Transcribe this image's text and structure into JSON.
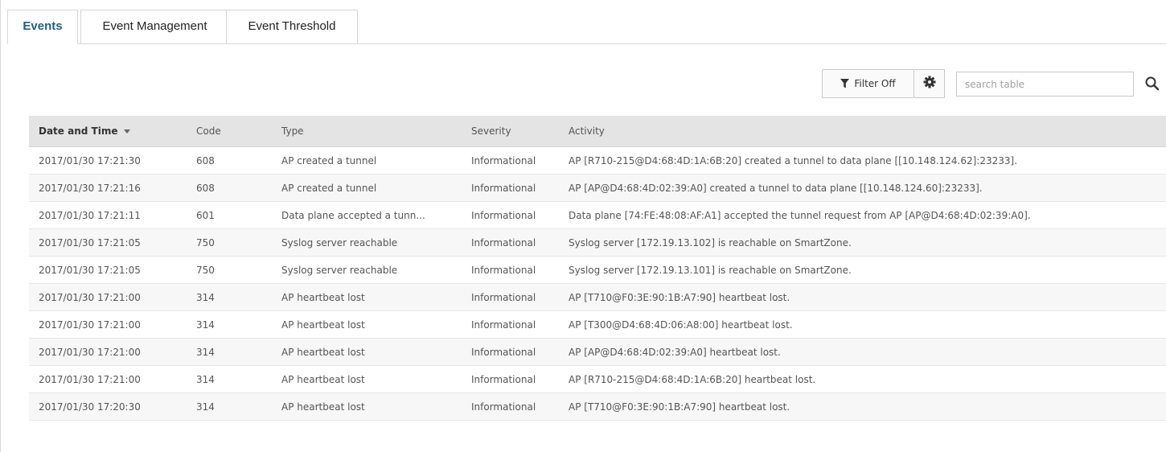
{
  "tabs": [
    {
      "label": "Events",
      "active": true
    },
    {
      "label": "Event Management",
      "active": false
    },
    {
      "label": "Event Threshold",
      "active": false
    }
  ],
  "toolbar": {
    "filter_label": "Filter Off",
    "filter_icon": "funnel-icon",
    "settings_icon": "gear-icon",
    "search_placeholder": "search table",
    "search_value": "",
    "search_icon": "search-icon"
  },
  "table": {
    "sort_column": "Date and Time",
    "sort_direction": "descending",
    "columns": [
      "Date and Time",
      "Code",
      "Type",
      "Severity",
      "Activity"
    ],
    "rows": [
      [
        "2017/01/30 17:21:30",
        "608",
        "AP created a tunnel",
        "Informational",
        "AP [R710-215@D4:68:4D:1A:6B:20] created a tunnel to data plane [[10.148.124.62]:23233]."
      ],
      [
        "2017/01/30 17:21:16",
        "608",
        "AP created a tunnel",
        "Informational",
        "AP [AP@D4:68:4D:02:39:A0] created a tunnel to data plane [[10.148.124.60]:23233]."
      ],
      [
        "2017/01/30 17:21:11",
        "601",
        "Data plane accepted a tunn...",
        "Informational",
        "Data plane [74:FE:48:08:AF:A1] accepted the tunnel request from AP [AP@D4:68:4D:02:39:A0]."
      ],
      [
        "2017/01/30 17:21:05",
        "750",
        "Syslog server reachable",
        "Informational",
        "Syslog server [172.19.13.102] is reachable on SmartZone."
      ],
      [
        "2017/01/30 17:21:05",
        "750",
        "Syslog server reachable",
        "Informational",
        "Syslog server [172.19.13.101] is reachable on SmartZone."
      ],
      [
        "2017/01/30 17:21:00",
        "314",
        "AP heartbeat lost",
        "Informational",
        "AP [T710@F0:3E:90:1B:A7:90] heartbeat lost."
      ],
      [
        "2017/01/30 17:21:00",
        "314",
        "AP heartbeat lost",
        "Informational",
        "AP [T300@D4:68:4D:06:A8:00] heartbeat lost."
      ],
      [
        "2017/01/30 17:21:00",
        "314",
        "AP heartbeat lost",
        "Informational",
        "AP [AP@D4:68:4D:02:39:A0] heartbeat lost."
      ],
      [
        "2017/01/30 17:21:00",
        "314",
        "AP heartbeat lost",
        "Informational",
        "AP [R710-215@D4:68:4D:1A:6B:20] heartbeat lost."
      ],
      [
        "2017/01/30 17:20:30",
        "314",
        "AP heartbeat lost",
        "Informational",
        "AP [T710@F0:3E:90:1B:A7:90] heartbeat lost."
      ]
    ]
  },
  "colors": {
    "active_tab_text": "#1f5f8b",
    "header_background": "#e4e4e4",
    "stripe_background": "#f7f7f7"
  }
}
